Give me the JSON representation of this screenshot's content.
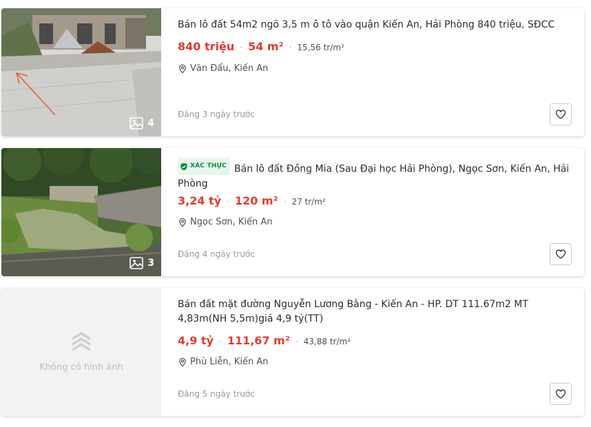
{
  "listings": [
    {
      "title": "Bán lô đất 54m2 ngõ 3,5 m ô tô vào quận Kiến An, Hải Phòng 840 triệu, SĐCC",
      "verified": false,
      "price": "840 triệu",
      "area": "54 m²",
      "price_per_m2": "15,56 tr/m²",
      "location": "Văn Đẩu, Kiến An",
      "posted": "Đăng 3 ngày trước",
      "image_count": "4",
      "has_image": true,
      "separator": "·"
    },
    {
      "title": "Bán lô đất Đồng Mia (Sau Đại học Hải Phòng), Ngọc Sơn, Kiến An, Hải Phòng",
      "verified": true,
      "verified_label": "XÁC THỰC",
      "price": "3,24 tỷ",
      "area": "120 m²",
      "price_per_m2": "27 tr/m²",
      "location": "Ngọc Sơn, Kiến An",
      "posted": "Đăng 4 ngày trước",
      "image_count": "3",
      "has_image": true,
      "separator": "·"
    },
    {
      "title": "Bán đất mặt đường Nguyễn Lương Bằng - Kiến An - HP. DT 111.67m2 MT 4,83m(NH 5,5m)giá 4,9 tỷ(TT)",
      "verified": false,
      "price": "4,9 tỷ",
      "area": "111,67 m²",
      "price_per_m2": "43,88 tr/m²",
      "location": "Phù Liễn, Kiến An",
      "posted": "Đăng 5 ngày trước",
      "has_image": false,
      "no_image_text": "Không có hình ảnh",
      "separator": "·"
    }
  ],
  "icons": {
    "gallery": "image-gallery-icon",
    "location": "map-pin-icon",
    "favorite": "heart-outline-icon",
    "verified": "shield-check-icon",
    "placeholder": "logo-placeholder-icon"
  },
  "colors": {
    "price": "#e03c31",
    "verified_bg": "#e6f6ec",
    "verified_text": "#0d8a43",
    "muted": "#999999"
  }
}
